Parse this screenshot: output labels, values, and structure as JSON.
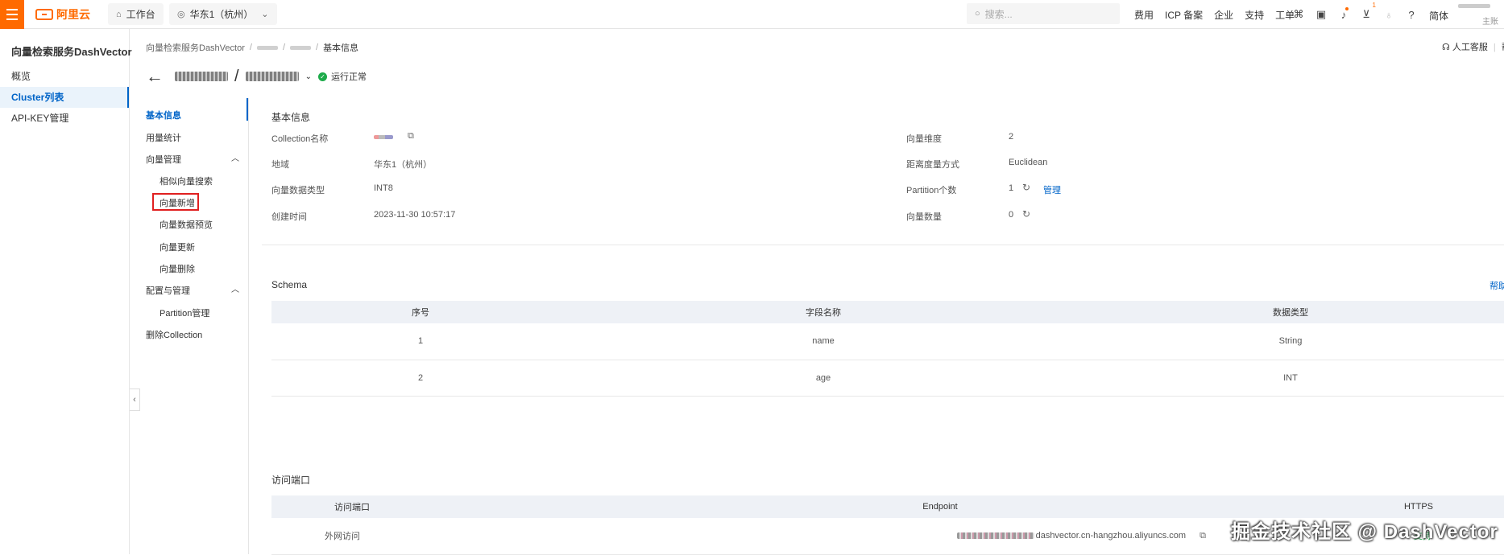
{
  "topbar": {
    "logo_text": "阿里云",
    "workbench": "工作台",
    "region": "华东1（杭州）",
    "search_placeholder": "搜索...",
    "links": [
      "费用",
      "ICP 备案",
      "企业",
      "支持",
      "工单"
    ],
    "cart_count": "1",
    "lang": "简体",
    "account_role": "主账"
  },
  "sidebar": {
    "title": "向量检索服务DashVector",
    "items": [
      {
        "label": "概览",
        "active": false
      },
      {
        "label": "Cluster列表",
        "active": true
      },
      {
        "label": "API-KEY管理",
        "active": false
      }
    ]
  },
  "breadcrumb": {
    "root": "向量检索服务DashVector",
    "current": "基本信息"
  },
  "header": {
    "slash": "/",
    "status": "运行正常",
    "support_link": "人工客服",
    "help_short": "帮"
  },
  "subnav": {
    "basic": "基本信息",
    "usage": "用量统计",
    "vector_mgmt": "向量管理",
    "similar_search": "相似向量搜索",
    "insert": "向量新增",
    "preview": "向量数据预览",
    "update": "向量更新",
    "delete": "向量删除",
    "config_mgmt": "配置与管理",
    "partition_mgmt": "Partition管理",
    "delete_collection": "删除Collection"
  },
  "basic_info": {
    "title": "基本信息",
    "collection_name_label": "Collection名称",
    "region_label": "地域",
    "region_value": "华东1（杭州）",
    "dtype_label": "向量数据类型",
    "dtype_value": "INT8",
    "created_label": "创建时间",
    "created_value": "2023-11-30 10:57:17",
    "dimension_label": "向量维度",
    "dimension_value": "2",
    "metric_label": "距离度量方式",
    "metric_value": "Euclidean",
    "partition_label": "Partition个数",
    "partition_value": "1",
    "manage_link": "管理",
    "count_label": "向量数量",
    "count_value": "0"
  },
  "schema": {
    "title": "Schema",
    "help": "帮助",
    "columns": [
      "序号",
      "字段名称",
      "数据类型"
    ],
    "rows": [
      [
        "1",
        "name",
        "String"
      ],
      [
        "2",
        "age",
        "INT"
      ]
    ]
  },
  "access": {
    "title": "访问端口",
    "columns": [
      "访问端口",
      "Endpoint",
      "HTTPS"
    ],
    "row": {
      "port": "外网访问",
      "endpoint": "dashvector.cn-hangzhou.aliyuncs.com",
      "https": "支持"
    }
  },
  "watermark": "掘金技术社区 @ DashVector"
}
